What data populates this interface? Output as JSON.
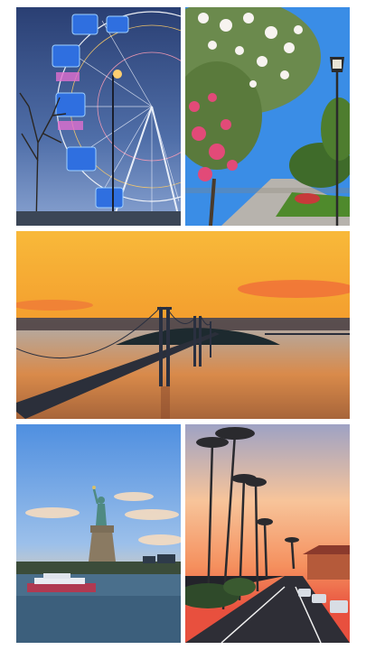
{
  "collage": {
    "background": "#ffffff",
    "photos": [
      {
        "subject": "ferris-wheel-at-dusk",
        "palette": [
          "#2a3f73",
          "#6f8cc6",
          "#2f6fe0"
        ]
      },
      {
        "subject": "flowering-oleander-street",
        "palette": [
          "#3a8de6",
          "#e24a78",
          "#3f6b2a"
        ]
      },
      {
        "subject": "bay-bridge-sunset",
        "palette": [
          "#f2ae34",
          "#f07c2a",
          "#1d2a3a"
        ]
      },
      {
        "subject": "statue-of-liberty",
        "palette": [
          "#6aa0e4",
          "#f6c98e",
          "#2f4f6a"
        ]
      },
      {
        "subject": "palm-tree-road-sunset",
        "palette": [
          "#f7c49a",
          "#f26a45",
          "#2a2a33"
        ]
      }
    ]
  }
}
